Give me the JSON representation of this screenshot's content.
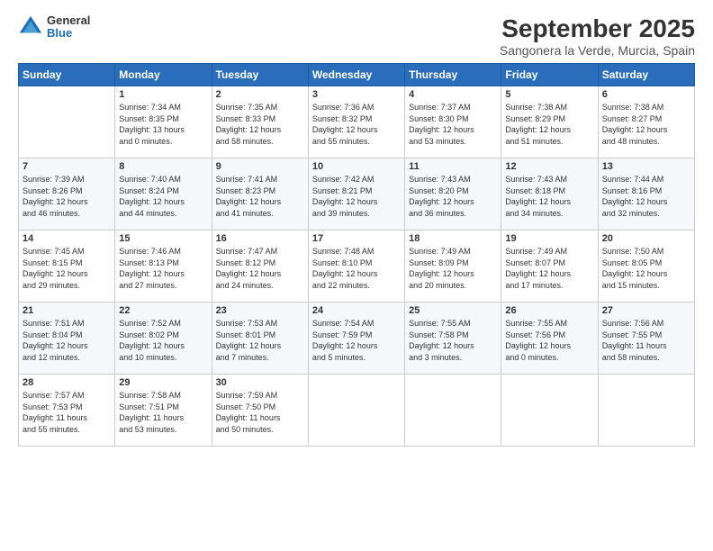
{
  "logo": {
    "general": "General",
    "blue": "Blue"
  },
  "header": {
    "month_title": "September 2025",
    "location": "Sangonera la Verde, Murcia, Spain"
  },
  "days_of_week": [
    "Sunday",
    "Monday",
    "Tuesday",
    "Wednesday",
    "Thursday",
    "Friday",
    "Saturday"
  ],
  "weeks": [
    [
      {
        "day": "",
        "info": ""
      },
      {
        "day": "1",
        "info": "Sunrise: 7:34 AM\nSunset: 8:35 PM\nDaylight: 13 hours\nand 0 minutes."
      },
      {
        "day": "2",
        "info": "Sunrise: 7:35 AM\nSunset: 8:33 PM\nDaylight: 12 hours\nand 58 minutes."
      },
      {
        "day": "3",
        "info": "Sunrise: 7:36 AM\nSunset: 8:32 PM\nDaylight: 12 hours\nand 55 minutes."
      },
      {
        "day": "4",
        "info": "Sunrise: 7:37 AM\nSunset: 8:30 PM\nDaylight: 12 hours\nand 53 minutes."
      },
      {
        "day": "5",
        "info": "Sunrise: 7:38 AM\nSunset: 8:29 PM\nDaylight: 12 hours\nand 51 minutes."
      },
      {
        "day": "6",
        "info": "Sunrise: 7:38 AM\nSunset: 8:27 PM\nDaylight: 12 hours\nand 48 minutes."
      }
    ],
    [
      {
        "day": "7",
        "info": "Sunrise: 7:39 AM\nSunset: 8:26 PM\nDaylight: 12 hours\nand 46 minutes."
      },
      {
        "day": "8",
        "info": "Sunrise: 7:40 AM\nSunset: 8:24 PM\nDaylight: 12 hours\nand 44 minutes."
      },
      {
        "day": "9",
        "info": "Sunrise: 7:41 AM\nSunset: 8:23 PM\nDaylight: 12 hours\nand 41 minutes."
      },
      {
        "day": "10",
        "info": "Sunrise: 7:42 AM\nSunset: 8:21 PM\nDaylight: 12 hours\nand 39 minutes."
      },
      {
        "day": "11",
        "info": "Sunrise: 7:43 AM\nSunset: 8:20 PM\nDaylight: 12 hours\nand 36 minutes."
      },
      {
        "day": "12",
        "info": "Sunrise: 7:43 AM\nSunset: 8:18 PM\nDaylight: 12 hours\nand 34 minutes."
      },
      {
        "day": "13",
        "info": "Sunrise: 7:44 AM\nSunset: 8:16 PM\nDaylight: 12 hours\nand 32 minutes."
      }
    ],
    [
      {
        "day": "14",
        "info": "Sunrise: 7:45 AM\nSunset: 8:15 PM\nDaylight: 12 hours\nand 29 minutes."
      },
      {
        "day": "15",
        "info": "Sunrise: 7:46 AM\nSunset: 8:13 PM\nDaylight: 12 hours\nand 27 minutes."
      },
      {
        "day": "16",
        "info": "Sunrise: 7:47 AM\nSunset: 8:12 PM\nDaylight: 12 hours\nand 24 minutes."
      },
      {
        "day": "17",
        "info": "Sunrise: 7:48 AM\nSunset: 8:10 PM\nDaylight: 12 hours\nand 22 minutes."
      },
      {
        "day": "18",
        "info": "Sunrise: 7:49 AM\nSunset: 8:09 PM\nDaylight: 12 hours\nand 20 minutes."
      },
      {
        "day": "19",
        "info": "Sunrise: 7:49 AM\nSunset: 8:07 PM\nDaylight: 12 hours\nand 17 minutes."
      },
      {
        "day": "20",
        "info": "Sunrise: 7:50 AM\nSunset: 8:05 PM\nDaylight: 12 hours\nand 15 minutes."
      }
    ],
    [
      {
        "day": "21",
        "info": "Sunrise: 7:51 AM\nSunset: 8:04 PM\nDaylight: 12 hours\nand 12 minutes."
      },
      {
        "day": "22",
        "info": "Sunrise: 7:52 AM\nSunset: 8:02 PM\nDaylight: 12 hours\nand 10 minutes."
      },
      {
        "day": "23",
        "info": "Sunrise: 7:53 AM\nSunset: 8:01 PM\nDaylight: 12 hours\nand 7 minutes."
      },
      {
        "day": "24",
        "info": "Sunrise: 7:54 AM\nSunset: 7:59 PM\nDaylight: 12 hours\nand 5 minutes."
      },
      {
        "day": "25",
        "info": "Sunrise: 7:55 AM\nSunset: 7:58 PM\nDaylight: 12 hours\nand 3 minutes."
      },
      {
        "day": "26",
        "info": "Sunrise: 7:55 AM\nSunset: 7:56 PM\nDaylight: 12 hours\nand 0 minutes."
      },
      {
        "day": "27",
        "info": "Sunrise: 7:56 AM\nSunset: 7:55 PM\nDaylight: 11 hours\nand 58 minutes."
      }
    ],
    [
      {
        "day": "28",
        "info": "Sunrise: 7:57 AM\nSunset: 7:53 PM\nDaylight: 11 hours\nand 55 minutes."
      },
      {
        "day": "29",
        "info": "Sunrise: 7:58 AM\nSunset: 7:51 PM\nDaylight: 11 hours\nand 53 minutes."
      },
      {
        "day": "30",
        "info": "Sunrise: 7:59 AM\nSunset: 7:50 PM\nDaylight: 11 hours\nand 50 minutes."
      },
      {
        "day": "",
        "info": ""
      },
      {
        "day": "",
        "info": ""
      },
      {
        "day": "",
        "info": ""
      },
      {
        "day": "",
        "info": ""
      }
    ]
  ]
}
